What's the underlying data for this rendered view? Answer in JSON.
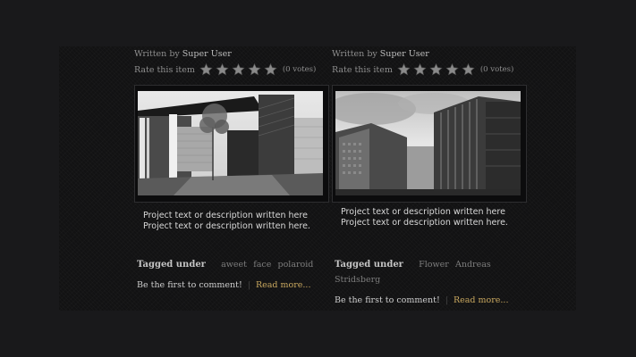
{
  "articles": [
    {
      "written_prefix": "Written by",
      "author": "Super User",
      "rate_label": "Rate this item",
      "rating": 0,
      "stars": 5,
      "votes": "(0 votes)",
      "description": "Project text or description written here Project text or description written here.",
      "tagged_label": "Tagged under",
      "tags": [
        "aweet",
        "face",
        "polaroid"
      ],
      "comment_prompt": "Be the first to comment!",
      "read_more": "Read more..."
    },
    {
      "written_prefix": "Written by",
      "author": "Super User",
      "rate_label": "Rate this item",
      "rating": 0,
      "stars": 5,
      "votes": "(0 votes)",
      "description": "Project text or description written here Project text or description written here.",
      "tagged_label": "Tagged under",
      "tags": [
        "Flower",
        "Andreas",
        "Stridsberg"
      ],
      "comment_prompt": "Be the first to comment!",
      "read_more": "Read more..."
    }
  ],
  "colors": {
    "background": "#19191b",
    "panel": "#121213",
    "link": "#c9a85f",
    "star": "#8a8a8a"
  },
  "icons": {
    "rating_star": "star-icon"
  }
}
